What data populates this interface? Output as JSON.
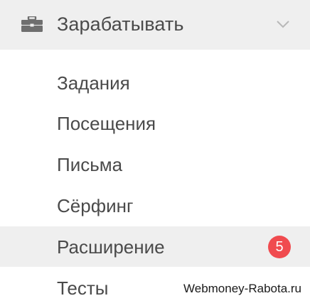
{
  "menu": {
    "header": {
      "icon": "briefcase-icon",
      "title": "Зарабатывать",
      "chevron": "chevron-down-icon"
    },
    "items": [
      {
        "label": "Задания"
      },
      {
        "label": "Посещения"
      },
      {
        "label": "Письма"
      },
      {
        "label": "Сёрфинг"
      },
      {
        "label": "Расширение",
        "badge": "5",
        "active": true
      },
      {
        "label": "Тесты"
      }
    ]
  },
  "watermark": "Webmoney-Rabota.ru",
  "colors": {
    "header_bg": "#efefef",
    "active_bg": "#efefef",
    "text": "#4a4a4a",
    "icon": "#6f6f6f",
    "badge": "#f04b4f"
  }
}
